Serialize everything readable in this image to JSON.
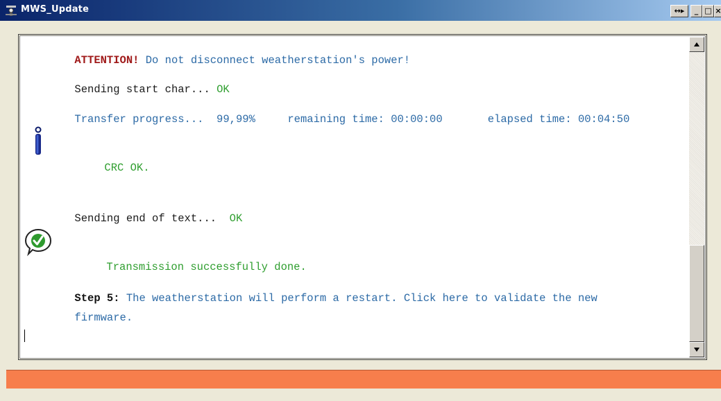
{
  "window": {
    "title": "MWS_Update",
    "pin_button": "↔▸",
    "minimize_button": "_",
    "maximize_button": "□",
    "close_button": "×"
  },
  "log": {
    "attention_label": "ATTENTION!",
    "attention_text": " Do not disconnect weatherstation's power!",
    "start_char_label": "Sending start char...",
    "start_char_status": " OK",
    "progress_label": "Transfer progress...",
    "progress_value": "  99,99%",
    "remaining_label": "     remaining time:",
    "remaining_value": " 00:00:00",
    "elapsed_label": "       elapsed time:",
    "elapsed_value": " 00:04:50",
    "crc_text": "CRC OK.",
    "end_text_label": "Sending end of text...",
    "end_text_status": "  OK",
    "success_text": "Transmission successfully done.",
    "step_label": "Step 5:",
    "step_text_1": " The weatherstation will perform a restart. Click here to validate the new",
    "step_text_2": "firmware."
  },
  "status_bar": {
    "progress": 1.0,
    "color": "#f77e4c"
  },
  "icons": {
    "app": "app-icon",
    "info": "info-icon",
    "success": "check-icon"
  }
}
